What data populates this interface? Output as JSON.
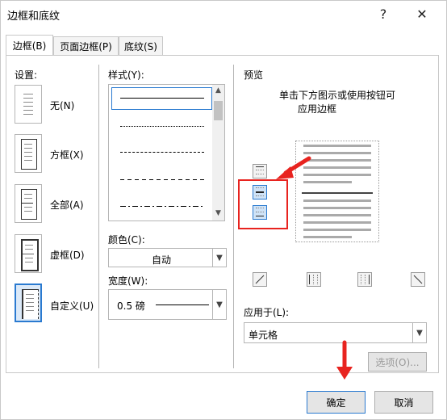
{
  "window": {
    "title": "边框和底纹",
    "help": "?",
    "close": "✕"
  },
  "tabs": [
    {
      "label": "边框(B)",
      "active": true
    },
    {
      "label": "页面边框(P)",
      "active": false
    },
    {
      "label": "底纹(S)",
      "active": false
    }
  ],
  "settings": {
    "heading": "设置:",
    "items": [
      {
        "label": "无(N)",
        "icon": "border-none-icon"
      },
      {
        "label": "方框(X)",
        "icon": "border-box-icon"
      },
      {
        "label": "全部(A)",
        "icon": "border-all-icon"
      },
      {
        "label": "虚框(D)",
        "icon": "border-grid-icon"
      },
      {
        "label": "自定义(U)",
        "icon": "border-custom-icon",
        "selected": true
      }
    ]
  },
  "style": {
    "heading": "样式(Y):",
    "options": [
      "solid",
      "dotted",
      "dashed-fine",
      "dashed",
      "dash-dot"
    ],
    "selected_index": 0
  },
  "color": {
    "label": "颜色(C):",
    "value": "自动"
  },
  "width": {
    "label": "宽度(W):",
    "value": "0.5 磅"
  },
  "preview": {
    "heading": "预览",
    "hint_line1": "单击下方图示或使用按钮可",
    "hint_line2": "应用边框"
  },
  "apply_to": {
    "label": "应用于(L):",
    "value": "单元格"
  },
  "buttons": {
    "options": "选项(O)...",
    "ok": "确定",
    "cancel": "取消"
  },
  "colors": {
    "accent": "#2a7ad0",
    "annotation": "#e8231f"
  }
}
